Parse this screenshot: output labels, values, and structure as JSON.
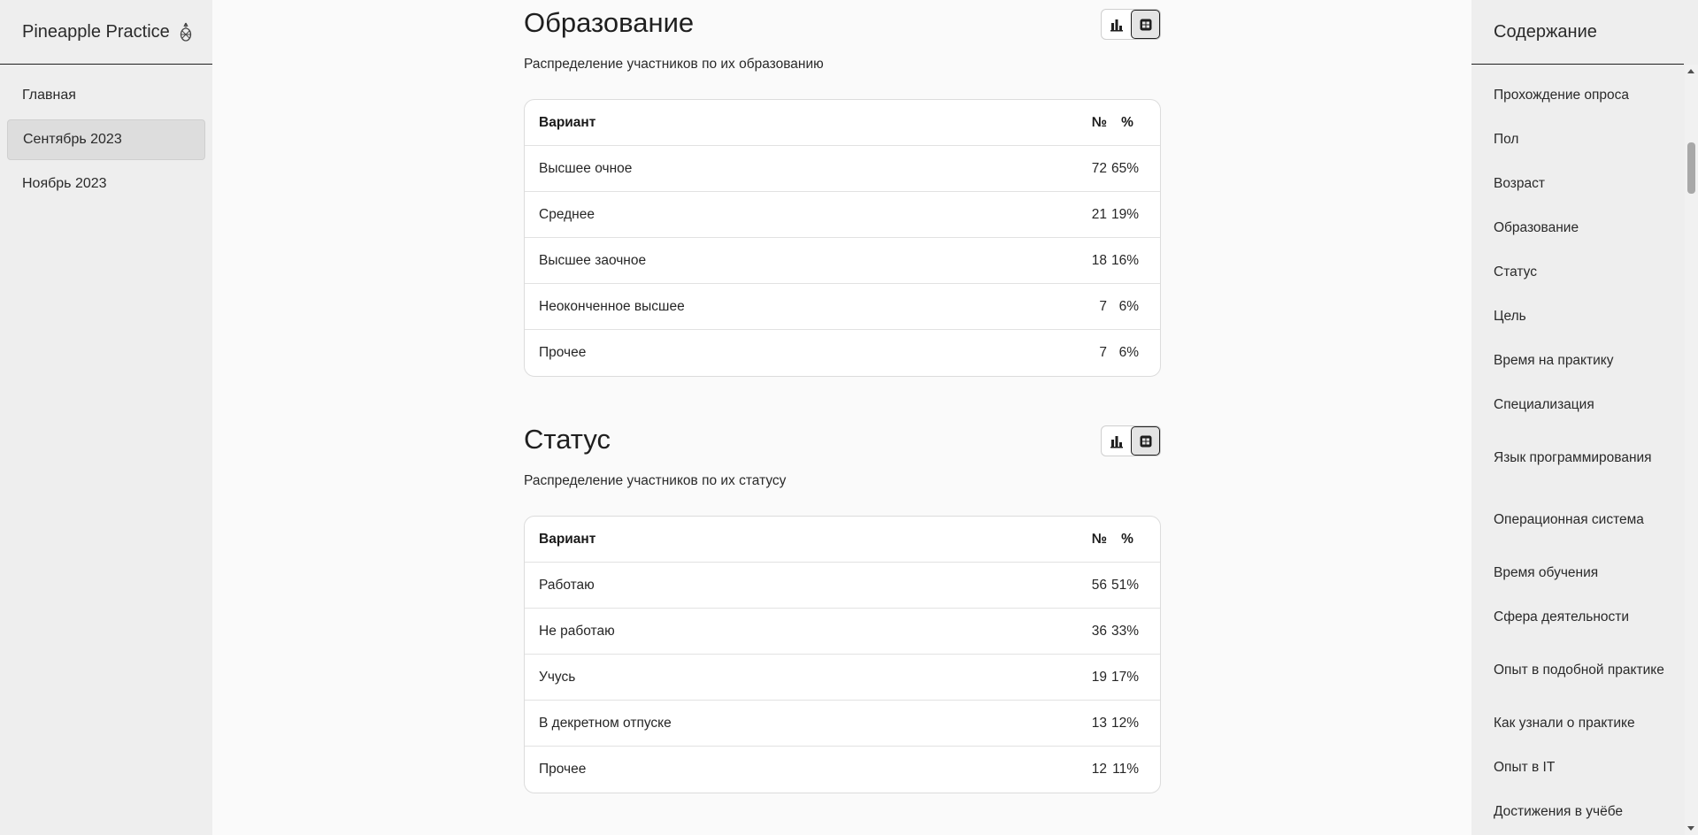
{
  "brand": {
    "name": "Pineapple Practice",
    "icon": "pineapple-icon"
  },
  "nav": {
    "items": [
      {
        "label": "Главная",
        "active": false
      },
      {
        "label": "Сентябрь 2023",
        "active": true
      },
      {
        "label": "Ноябрь 2023",
        "active": false
      }
    ]
  },
  "sections": [
    {
      "title": "Образование",
      "subtitle": "Распределение участников по их образованию",
      "view": "table",
      "headers": {
        "option": "Вариант",
        "num": "№",
        "pct": "%"
      },
      "rows": [
        {
          "option": "Высшее очное",
          "num": "72",
          "pct": "65%"
        },
        {
          "option": "Среднее",
          "num": "21",
          "pct": "19%"
        },
        {
          "option": "Высшее заочное",
          "num": "18",
          "pct": "16%"
        },
        {
          "option": "Неоконченное высшее",
          "num": "7",
          "pct": "6%"
        },
        {
          "option": "Прочее",
          "num": "7",
          "pct": "6%"
        }
      ]
    },
    {
      "title": "Статус",
      "subtitle": "Распределение участников по их статусу",
      "view": "table",
      "headers": {
        "option": "Вариант",
        "num": "№",
        "pct": "%"
      },
      "rows": [
        {
          "option": "Работаю",
          "num": "56",
          "pct": "51%"
        },
        {
          "option": "Не работаю",
          "num": "36",
          "pct": "33%"
        },
        {
          "option": "Учусь",
          "num": "19",
          "pct": "17%"
        },
        {
          "option": "В декретном отпуске",
          "num": "13",
          "pct": "12%"
        },
        {
          "option": "Прочее",
          "num": "12",
          "pct": "11%"
        }
      ]
    }
  ],
  "toc": {
    "title": "Содержание",
    "items": [
      "Прохождение опроса",
      "Пол",
      "Возраст",
      "Образование",
      "Статус",
      "Цель",
      "Время на практику",
      "Специализация",
      "Язык программирования",
      "Операционная система",
      "Время обучения",
      "Сфера деятельности",
      "Опыт в подобной практике",
      "Как узнали о практике",
      "Опыт в IT",
      "Достижения в учёбе"
    ]
  },
  "colors": {
    "sidebar_bg": "#eeeeee",
    "page_bg": "#fafafa",
    "card_bg": "#ffffff",
    "text": "#1f1f1f"
  }
}
